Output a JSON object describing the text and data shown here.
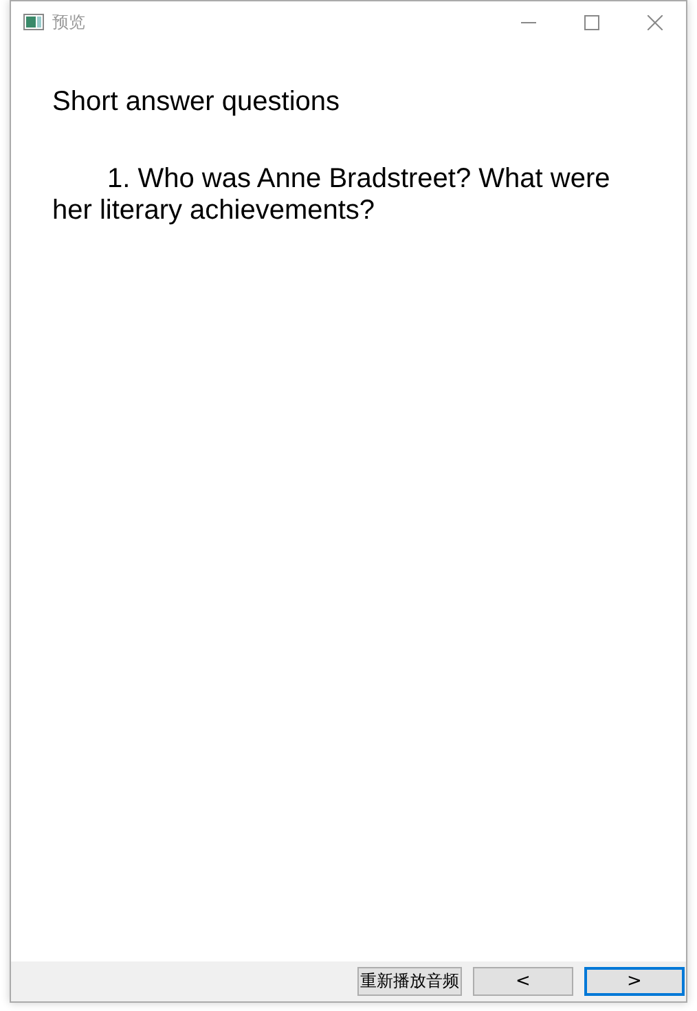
{
  "window": {
    "title": "预览"
  },
  "heading": "Short answer questions",
  "question": "1. Who was Anne Bradstreet? What were her literary achievements?",
  "buttons": [
    {
      "label": "重新播放音频",
      "focused": false
    },
    {
      "label": "<",
      "focused": false
    },
    {
      "label": ">",
      "focused": true
    }
  ]
}
